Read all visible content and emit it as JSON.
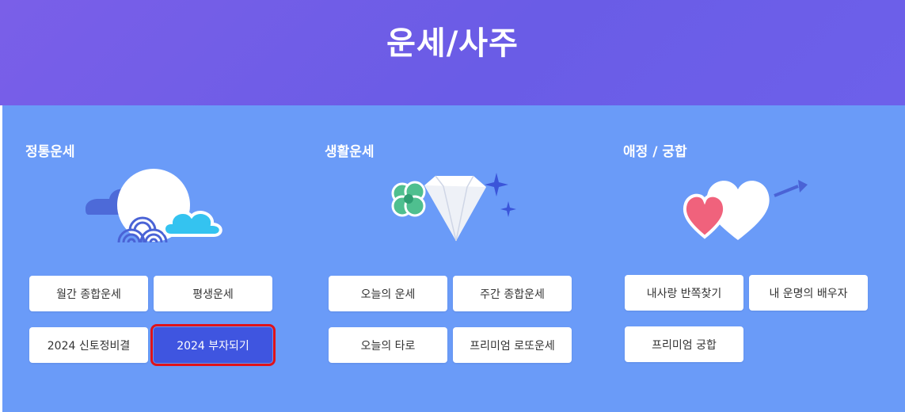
{
  "header": {
    "title": "운세/사주"
  },
  "sections": [
    {
      "title": "정통운세",
      "illustration": "moon-wave-cloud",
      "buttons": [
        "월간 종합운세",
        "평생운세",
        "2024 신토정비결",
        "2024 부자되기"
      ]
    },
    {
      "title": "생활운세",
      "illustration": "clover-diamond-sparkles",
      "buttons": [
        "오늘의 운세",
        "주간 종합운세",
        "오늘의 타로",
        "프리미엄 로또운세"
      ]
    },
    {
      "title": "애정 / 궁합",
      "illustration": "hearts-arrow",
      "buttons": [
        "내사랑 반쪽찾기",
        "내 운명의 배우자",
        "프리미엄 궁합"
      ]
    }
  ],
  "selected_button": "2024 부자되기",
  "colors": {
    "header_bg": "#6e5ee8",
    "main_bg": "#6a9bf8",
    "button_bg": "#ffffff",
    "selected_bg": "#3f55e0",
    "highlight_border": "#e0121a"
  }
}
